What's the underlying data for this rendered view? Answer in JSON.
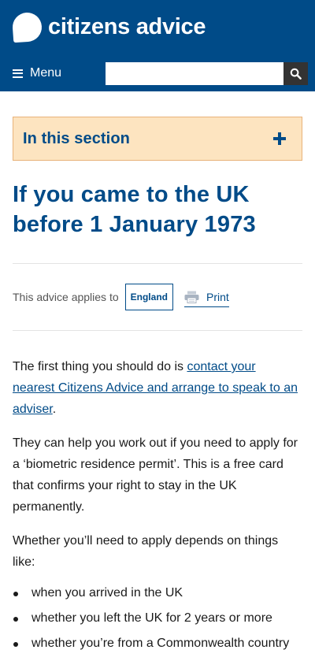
{
  "brand": {
    "name": "citizens advice"
  },
  "nav": {
    "menu_label": "Menu",
    "search_placeholder": "",
    "search_value": ""
  },
  "section_toggle": {
    "label": "In this section"
  },
  "page_title": "If you came to the UK before 1 January 1973",
  "applies": {
    "label": "This advice applies to",
    "country": "England",
    "print_label": "Print"
  },
  "body": {
    "p1_before": "The first thing you should do is ",
    "p1_link": "contact your nearest Citizens Advice and arrange to speak to an adviser",
    "p1_after": ".",
    "p2": "They can help you work out if you need to apply for a ‘biometric residence permit’. This is a free card that confirms your right to stay in the UK permanently.",
    "p3": "Whether you’ll need to apply depends on things like:",
    "bullets": [
      "when you arrived in the UK",
      "whether you left the UK for 2 years or more",
      "whether you’re from a Commonwealth country"
    ]
  },
  "colors": {
    "brand_blue": "#004b88",
    "section_bg": "#fde4c0",
    "search_button": "#333333"
  },
  "icons": {
    "menu": "hamburger-icon",
    "search": "search-icon",
    "expand": "plus-icon",
    "print": "printer-icon"
  }
}
